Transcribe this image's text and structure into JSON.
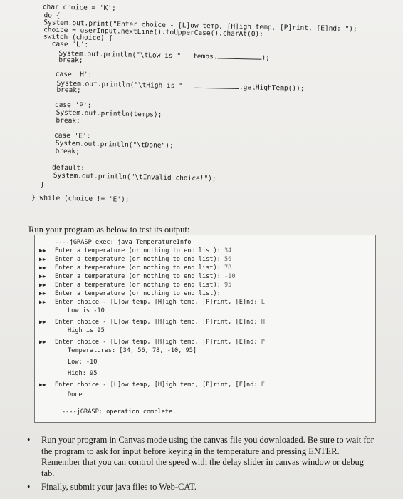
{
  "code": {
    "l1": "char choice = 'K';",
    "l2": "do {",
    "l3": "System.out.print(\"Enter choice - [L]ow temp, [H]igh temp, [P]rint, [E]nd: \");",
    "l4": "choice = userInput.nextLine().toUpperCase().charAt(0);",
    "l5": "switch (choice) {",
    "l6": "case 'L':",
    "l7": "System.out.println(\"\\tLow is \" + temps.",
    "l7b": ");",
    "l8": "break;",
    "l9": "case 'H':",
    "l10": "System.out.println(\"\\tHigh is \" + ",
    "l10b": ".getHighTemp());",
    "l11": "break;",
    "l12": "case 'P':",
    "l13": "System.out.println(temps);",
    "l14": "break;",
    "l15": "case 'E':",
    "l16": "System.out.println(\"\\tDone\");",
    "l17": "break;",
    "l18": "default:",
    "l19": "System.out.println(\"\\tInvalid choice!\");",
    "l20": "}",
    "l21": "} while (choice != 'E');"
  },
  "heading": "Run your program as below to test its output:",
  "terminal": [
    {
      "text": "----jGRASP exec: java TemperatureInfo"
    },
    {
      "text": "Enter a temperature (or nothing to end list): ",
      "input": "34"
    },
    {
      "text": "Enter a temperature (or nothing to end list): ",
      "input": "56"
    },
    {
      "text": "Enter a temperature (or nothing to end list): ",
      "input": "78"
    },
    {
      "text": "Enter a temperature (or nothing to end list): ",
      "input": "-10"
    },
    {
      "text": "Enter a temperature (or nothing to end list): ",
      "input": "95"
    },
    {
      "text": "Enter a temperature (or nothing to end list):",
      "input": ""
    },
    {
      "text": "Enter choice - [L]ow temp, [H]igh temp, [P]rint, [E]nd: ",
      "input": "L"
    },
    {
      "text": "Low is -10"
    },
    {
      "text": "Enter choice - [L]ow temp, [H]igh temp, [P]rint, [E]nd: ",
      "input": "H"
    },
    {
      "text": "High is 95"
    },
    {
      "text": "Enter choice - [L]ow temp, [H]igh temp, [P]rint, [E]nd: ",
      "input": "P"
    },
    {
      "text": "Temperatures: [34, 56, 78, -10, 95]"
    },
    {
      "text": "Low: -10"
    },
    {
      "text": "High: 95"
    },
    {
      "text": "Enter choice - [L]ow temp, [H]igh temp, [P]rint, [E]nd: ",
      "input": "E"
    },
    {
      "text": "Done"
    },
    {
      "text": "----jGRASP: operation complete."
    }
  ],
  "bullets": [
    "Run your program in Canvas mode using the canvas file you downloaded. Be sure to wait for the program to ask for input before keying in the temperature and pressing ENTER. Remember that you can control the speed with the delay slider in canvas window or debug tab.",
    "Finally, submit your java files to Web-CAT."
  ]
}
